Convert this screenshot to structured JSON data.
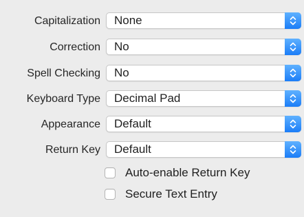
{
  "accent_color": "#1b7df7",
  "fields": [
    {
      "label": "Capitalization",
      "value": "None"
    },
    {
      "label": "Correction",
      "value": "No"
    },
    {
      "label": "Spell Checking",
      "value": "No"
    },
    {
      "label": "Keyboard Type",
      "value": "Decimal Pad"
    },
    {
      "label": "Appearance",
      "value": "Default"
    },
    {
      "label": "Return Key",
      "value": "Default"
    }
  ],
  "checkboxes": [
    {
      "label": "Auto-enable Return Key",
      "checked": false
    },
    {
      "label": "Secure Text Entry",
      "checked": false
    }
  ],
  "icons": {
    "popup_arrows": "up-down-chevrons-icon"
  }
}
